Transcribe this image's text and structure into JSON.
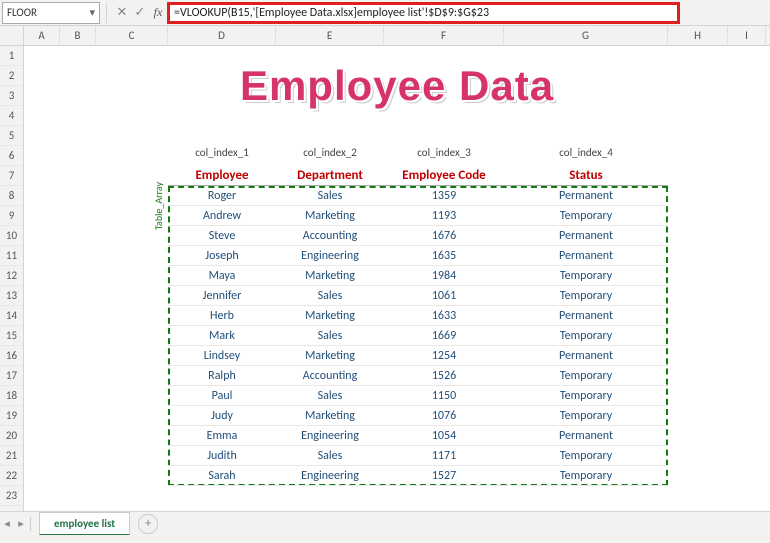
{
  "namebox": {
    "value": "FLOOR"
  },
  "formula_bar": {
    "formula": "=VLOOKUP(B15,'[Employee Data.xlsx]employee list'!$D$9:$G$23"
  },
  "columns": [
    "A",
    "B",
    "C",
    "D",
    "E",
    "F",
    "G",
    "H",
    "I"
  ],
  "row_numbers": [
    1,
    2,
    3,
    4,
    5,
    6,
    7,
    8,
    9,
    10,
    11,
    12,
    13,
    14,
    15,
    16,
    17,
    18,
    19,
    20,
    21,
    22,
    23
  ],
  "title": "Employee Data",
  "col_index_labels": [
    "col_index_1",
    "col_index_2",
    "col_index_3",
    "col_index_4"
  ],
  "headers": [
    "Employee",
    "Department",
    "Employee Code",
    "Status"
  ],
  "table_array_label": "Table_Array",
  "data": [
    {
      "employee": "Roger",
      "department": "Sales",
      "code": "1359",
      "status": "Permanent"
    },
    {
      "employee": "Andrew",
      "department": "Marketing",
      "code": "1193",
      "status": "Temporary"
    },
    {
      "employee": "Steve",
      "department": "Accounting",
      "code": "1676",
      "status": "Permanent"
    },
    {
      "employee": "Joseph",
      "department": "Engineering",
      "code": "1635",
      "status": "Permanent"
    },
    {
      "employee": "Maya",
      "department": "Marketing",
      "code": "1984",
      "status": "Temporary"
    },
    {
      "employee": "Jennifer",
      "department": "Sales",
      "code": "1061",
      "status": "Temporary"
    },
    {
      "employee": "Herb",
      "department": "Marketing",
      "code": "1633",
      "status": "Permanent"
    },
    {
      "employee": "Mark",
      "department": "Sales",
      "code": "1669",
      "status": "Temporary"
    },
    {
      "employee": "Lindsey",
      "department": "Marketing",
      "code": "1254",
      "status": "Permanent"
    },
    {
      "employee": "Ralph",
      "department": "Accounting",
      "code": "1526",
      "status": "Temporary"
    },
    {
      "employee": "Paul",
      "department": "Sales",
      "code": "1150",
      "status": "Temporary"
    },
    {
      "employee": "Judy",
      "department": "Marketing",
      "code": "1076",
      "status": "Temporary"
    },
    {
      "employee": "Emma",
      "department": "Engineering",
      "code": "1054",
      "status": "Permanent"
    },
    {
      "employee": "Judith",
      "department": "Sales",
      "code": "1171",
      "status": "Temporary"
    },
    {
      "employee": "Sarah",
      "department": "Engineering",
      "code": "1527",
      "status": "Temporary"
    }
  ],
  "sheet_tabs": {
    "active": "employee list"
  }
}
